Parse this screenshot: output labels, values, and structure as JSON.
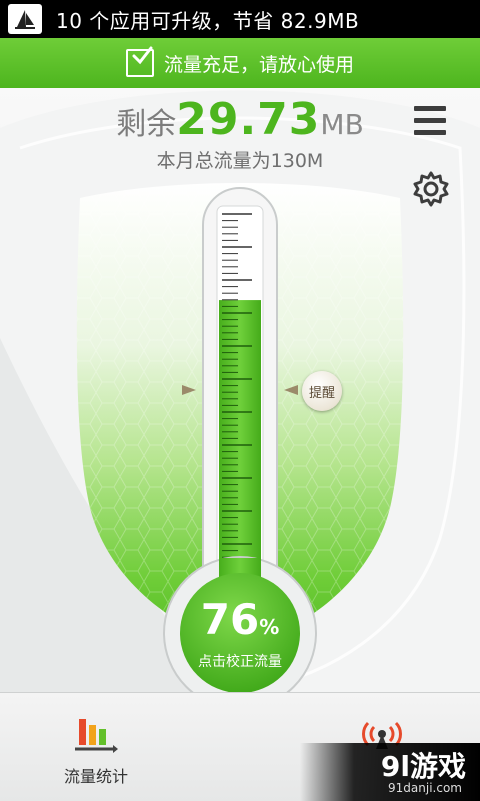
{
  "status_bar": {
    "notification": "10 个应用可升级，节省 82.9MB",
    "app_icon": "sail-logo-icon"
  },
  "banner": {
    "text": "流量充足，请放心使用",
    "icon": "checkbox-icon"
  },
  "summary": {
    "remaining_prefix": "剩余",
    "remaining_value": "29.73",
    "remaining_unit": "MB",
    "monthly_total": "本月总流量为130M"
  },
  "header_icons": {
    "menu": "menu-icon",
    "settings": "gear-icon"
  },
  "thermometer": {
    "remind_label": "提醒",
    "percent": "76",
    "percent_sign": "%",
    "calibrate_hint": "点击校正流量",
    "fill_fraction": 0.76
  },
  "bottom_bar": {
    "stats_label": "流量统计",
    "stats_icon": "bar-chart-icon",
    "signal_icon": "signal-tower-icon"
  },
  "watermark": {
    "brand": "9l游戏",
    "site": "91danji.com"
  },
  "colors": {
    "accent_green": "#4db51e",
    "banner_green": "#6fcd38"
  }
}
